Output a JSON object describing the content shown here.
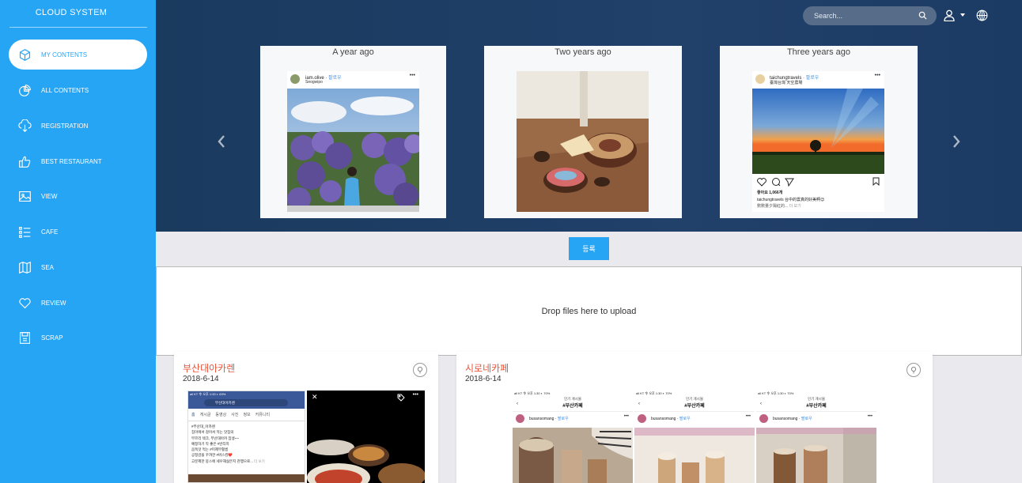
{
  "sidebar": {
    "brand": "CLOUD SYSTEM",
    "items": [
      {
        "label": "MY CONTENTS",
        "icon": "cube-icon",
        "active": true
      },
      {
        "label": "ALL CONTENTS",
        "icon": "pie-chart-icon"
      },
      {
        "label": "REGISTRATION",
        "icon": "cloud-download-icon"
      },
      {
        "label": "BEST RESTAURANT",
        "icon": "thumbs-up-icon"
      },
      {
        "label": "VIEW",
        "icon": "image-icon"
      },
      {
        "label": "CAFE",
        "icon": "list-icon"
      },
      {
        "label": "SEA",
        "icon": "map-icon"
      },
      {
        "label": "REVIEW",
        "icon": "heart-icon"
      },
      {
        "label": "SCRAP",
        "icon": "floppy-icon"
      }
    ]
  },
  "header": {
    "search_placeholder": "Search..."
  },
  "memories": [
    {
      "title": "A year ago",
      "account": "iam.olive",
      "follow": "팔로우",
      "location": "Seogwipo"
    },
    {
      "title": "Two years ago"
    },
    {
      "title": "Three years ago",
      "account": "taichungtravels",
      "follow": "팔로우",
      "location": "臺灣台灣 天空農場",
      "likes": "좋아요 1,066개",
      "caption": "taichungtravels 台中的雲真的好美啊😊",
      "caption2": "數數量夕陽紅的...",
      "more": "더 보기"
    }
  ],
  "register_label": "등록",
  "dropzone_text": "Drop files here to upload",
  "posts": [
    {
      "title": "부산대아카렌",
      "date": "2018-6-14",
      "phone": {
        "status": "all KT 令  오후 1:33  ◐ 63%",
        "search": "부산대아카렌",
        "tabs": [
          "홈",
          "게시글",
          "동영상",
          "사진",
          "정보",
          "커뮤니티"
        ],
        "lines": [
          "#부산대_아카렌",
          "집이에서 걸어서 먹는 맛집의",
          "부르리 텍크, 부산대아카 집생~~",
          "예정하기 막 좋은 #빈티지",
          "음독맛 먹는 #미제무활름",
          "공정감을 꾸까한 #버스킹❤️",
          "고분제한 뭉스에 세우해싫은지 관행으로..."
        ],
        "more": "더 보기"
      }
    },
    {
      "title": "시로네카페",
      "date": "2018-6-14",
      "shots": [
        {
          "status": "all KT 令  오후 1:30  ◐ 70%",
          "header": "인기 게시물",
          "tag": "#부산카페",
          "account": "busansomang",
          "follow": "팔로우"
        },
        {
          "status": "all KT 令  오후 1:30  ◐ 70%",
          "header": "인기 게시물",
          "tag": "#부산카페",
          "account": "busansomang",
          "follow": "팔로우"
        },
        {
          "status": "all KT 令  오후 1:30  ◐ 70%",
          "header": "인기 게시물",
          "tag": "#부산카페",
          "account": "busansomang",
          "follow": "팔로우"
        }
      ]
    }
  ]
}
